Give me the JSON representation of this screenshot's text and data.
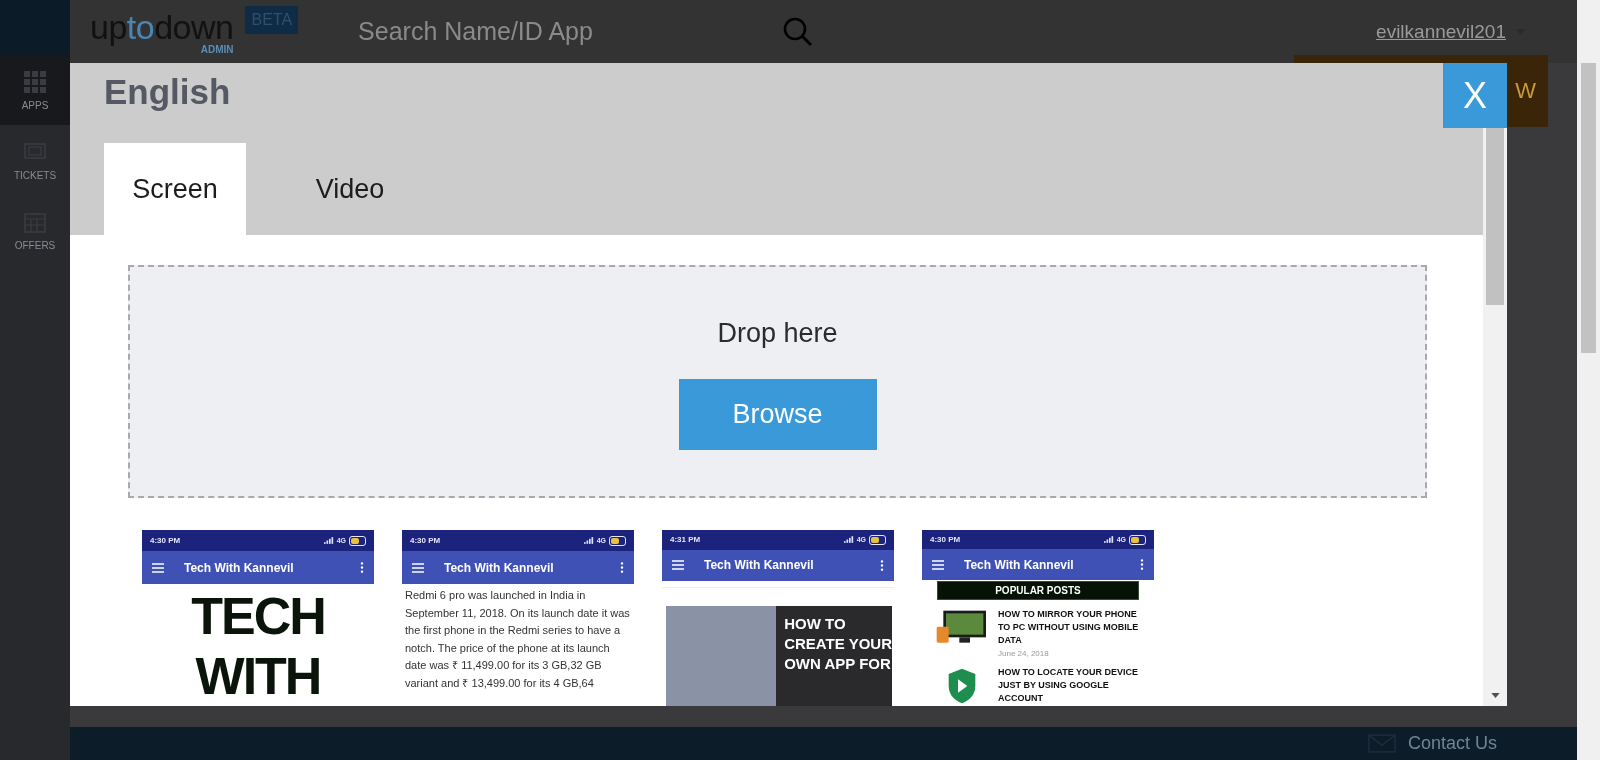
{
  "header": {
    "logo_parts": [
      {
        "text": "up",
        "accent": false
      },
      {
        "text": "to",
        "accent": true
      },
      {
        "text": "down",
        "accent": false
      }
    ],
    "logo_sub": "ADMIN",
    "badge": "BETA",
    "search": {
      "placeholder": "Search Name/ID App"
    },
    "user": "evilkannevil201"
  },
  "sidebar": {
    "items": [
      {
        "label": "APPS",
        "kind": "grid",
        "selected": true
      },
      {
        "label": "TICKETS",
        "kind": "ticket",
        "selected": false
      },
      {
        "label": "OFFERS",
        "kind": "calendar",
        "selected": false
      }
    ]
  },
  "action_button": {
    "label": "W"
  },
  "footer": {
    "contact": "Contact Us"
  },
  "modal": {
    "title": "English",
    "close": "X",
    "tabs": [
      {
        "label": "Screen",
        "selected": true
      },
      {
        "label": "Video",
        "selected": false
      }
    ],
    "dropzone": {
      "text": "Drop here",
      "button": "Browse"
    },
    "screenshots": [
      {
        "kind": "logo",
        "time": "4:30 PM",
        "network": "4G",
        "title": "Tech With Kannevil",
        "lines": [
          "TECH",
          "WITH"
        ]
      },
      {
        "kind": "article",
        "time": "4:30 PM",
        "network": "4G",
        "title": "Tech With Kannevil",
        "text": "Redmi 6 pro was launched in India in September 11, 2018. On its launch date it was the first phone in the Redmi series to have a notch. The price of the phone at its launch date was ₹ 11,499.00 for its 3 GB,32 GB variant and ₹ 13,499.00 for its 4 GB,64"
      },
      {
        "kind": "post",
        "time": "4:31 PM",
        "network": "4G",
        "title": "Tech With Kannevil",
        "lines": [
          "HOW TO",
          "CREATE YOUR",
          "OWN APP FOR"
        ]
      },
      {
        "kind": "popular",
        "time": "4:30 PM",
        "network": "4G",
        "title": "Tech With Kannevil",
        "heading": "POPULAR POSTS",
        "posts": [
          {
            "kind": "monitor",
            "title": "HOW TO MIRROR YOUR PHONE TO PC WITHOUT USING MOBILE DATA",
            "date": "June 24, 2018"
          },
          {
            "kind": "shield",
            "title": "HOW TO LOCATE YOUR DEVICE JUST BY USING GOOGLE ACCOUNT"
          }
        ]
      }
    ]
  }
}
